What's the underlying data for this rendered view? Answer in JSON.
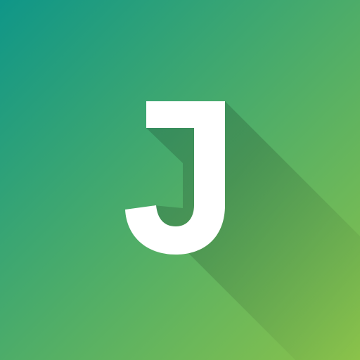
{
  "logo": {
    "letter": "J",
    "colors": {
      "gradient_start": "#0f9688",
      "gradient_end": "#8bc34a",
      "letter": "#ffffff",
      "long_shadow": "#000000"
    }
  }
}
